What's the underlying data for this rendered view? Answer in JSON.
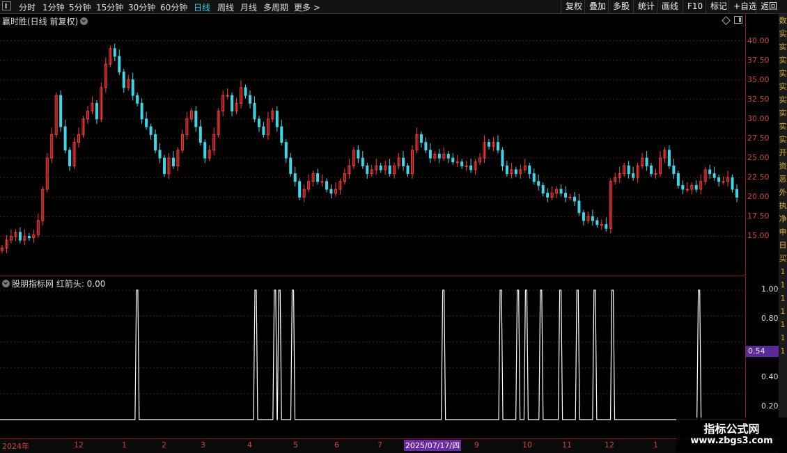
{
  "toolbar": {
    "periods": [
      "分时",
      "1分钟",
      "5分钟",
      "15分钟",
      "30分钟",
      "60分钟",
      "日线",
      "周线",
      "月线",
      "多周期",
      "更多 >"
    ],
    "active_period": "日线",
    "tools": [
      "复权",
      "叠加",
      "多股",
      "统计",
      "画线",
      "F10",
      "标记",
      "+自选",
      "返回"
    ]
  },
  "price_panel": {
    "title": "赢时胜(日线 前复权)",
    "yticks": [
      "40.00",
      "37.50",
      "35.00",
      "32.50",
      "30.00",
      "27.50",
      "25.00",
      "22.50",
      "20.00",
      "17.50",
      "15.00"
    ]
  },
  "indicator_panel": {
    "title": "股朋指标网 红箭头: 0.00",
    "yticks": [
      "1.00",
      "0.80",
      "0.60",
      "0.40",
      "0.20"
    ],
    "marker_value": "0.54"
  },
  "time_axis": {
    "labels": [
      "2024年",
      "12",
      "1",
      "2",
      "3",
      "4",
      "5",
      "6",
      "7",
      "2025/07/17/四",
      "9",
      "10",
      "11",
      "12",
      "1"
    ]
  },
  "sidebar": {
    "chars": [
      "数",
      "实",
      "实",
      "实",
      "实",
      "实",
      "实",
      "实",
      "实",
      "实",
      "开",
      "资",
      "恶",
      "外",
      "执",
      "净",
      "申",
      "日",
      "买",
      "1",
      "1",
      "1",
      "1",
      "1",
      "1",
      "1"
    ]
  },
  "watermark": {
    "line1": "指标公式网",
    "line2": "www.zbgs3.com"
  },
  "chart_data": [
    {
      "type": "candlestick",
      "title": "赢时胜(日线 前复权)",
      "ylim": [
        12.5,
        42.5
      ],
      "close_approx": [
        13.5,
        14.5,
        15,
        15.5,
        14.5,
        15,
        14.8,
        15.2,
        17,
        21,
        25,
        28,
        33,
        29,
        26,
        24,
        27,
        28,
        30,
        31,
        32,
        30,
        34,
        37,
        39,
        38,
        36,
        34,
        35,
        33,
        32,
        30,
        29,
        28,
        26,
        25,
        23,
        25,
        24,
        26,
        28,
        30,
        31,
        29,
        27,
        25,
        26,
        28,
        31,
        33,
        33,
        31,
        32,
        34,
        33,
        32,
        30,
        29,
        28,
        30,
        31,
        29,
        27,
        25,
        23,
        22,
        20,
        21,
        22,
        23,
        22,
        22,
        21,
        20.5,
        21,
        22,
        23,
        24,
        26,
        25,
        24,
        23,
        23.5,
        24,
        23.5,
        24,
        23,
        24,
        25,
        24,
        23,
        26,
        28,
        27,
        26,
        25,
        25.5,
        25,
        25.5,
        25,
        24.5,
        24.5,
        24,
        24,
        23.5,
        24.5,
        25,
        27,
        26.5,
        27,
        26,
        24,
        23,
        23.5,
        23,
        23.5,
        24,
        23,
        22,
        21.5,
        20.5,
        20,
        20.5,
        21,
        20.5,
        20,
        20,
        19.5,
        18,
        17,
        17.5,
        17,
        16.5,
        16.5,
        16,
        22,
        22.5,
        23,
        24,
        23,
        22.5,
        24,
        25,
        24,
        23,
        23,
        25,
        26,
        24,
        23,
        21.5,
        21,
        21,
        21.5,
        21,
        22,
        23.5,
        23,
        22.5,
        22,
        22,
        22.5,
        21,
        20
      ]
    },
    {
      "type": "line",
      "name": "红箭头",
      "ylim": [
        0,
        1.1
      ],
      "spikes_at_fraction_of_width": [
        0.184,
        0.343,
        0.369,
        0.375,
        0.393,
        0.595,
        0.672,
        0.695,
        0.706,
        0.726,
        0.752,
        0.775,
        0.798,
        0.822,
        0.938
      ],
      "spike_value": 1.0,
      "baseline": 0
    }
  ]
}
